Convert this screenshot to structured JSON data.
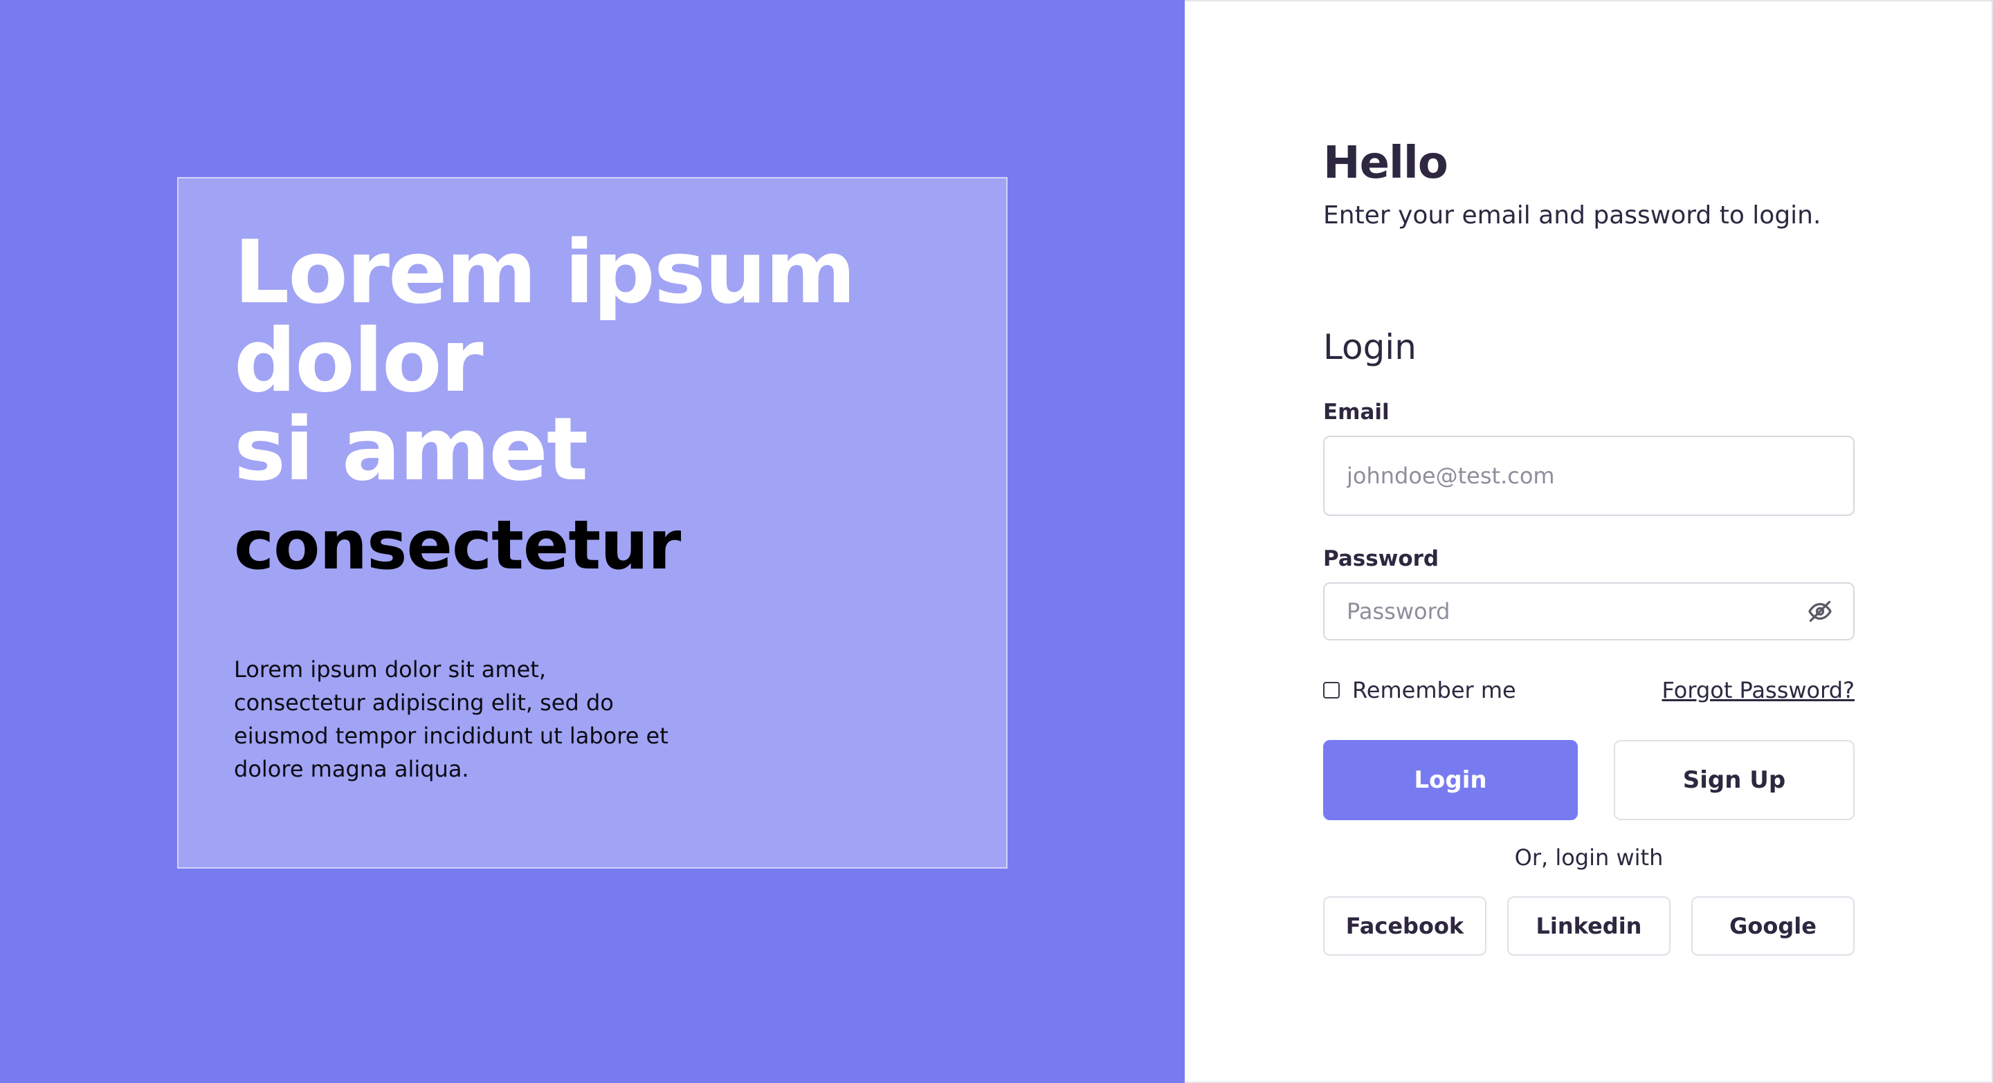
{
  "colors": {
    "accent": "#787BF0",
    "hero_card": "#A1A3F4",
    "text_dark": "#2E2740",
    "white": "#FFFFFF"
  },
  "hero": {
    "title_lines": [
      "Lorem ipsum",
      "dolor",
      "si amet"
    ],
    "subtitle": "consectetur",
    "body": "Lorem ipsum dolor sit amet, consectetur adipiscing elit, sed do eiusmod tempor incididunt ut labore et dolore magna aliqua."
  },
  "login": {
    "greeting": "Hello",
    "greeting_sub": "Enter your email and password to login.",
    "form_heading": "Login",
    "email": {
      "label": "Email",
      "placeholder": "johndoe@test.com",
      "value": ""
    },
    "password": {
      "label": "Password",
      "placeholder": "Password",
      "value": "",
      "toggle_icon": "eye-off-icon"
    },
    "remember_label": "Remember me",
    "remember_checked": false,
    "forgot_label": "Forgot Password?",
    "login_button": "Login",
    "signup_button": "Sign Up",
    "alt_text": "Or, login with",
    "social": [
      "Facebook",
      "Linkedin",
      "Google"
    ]
  }
}
